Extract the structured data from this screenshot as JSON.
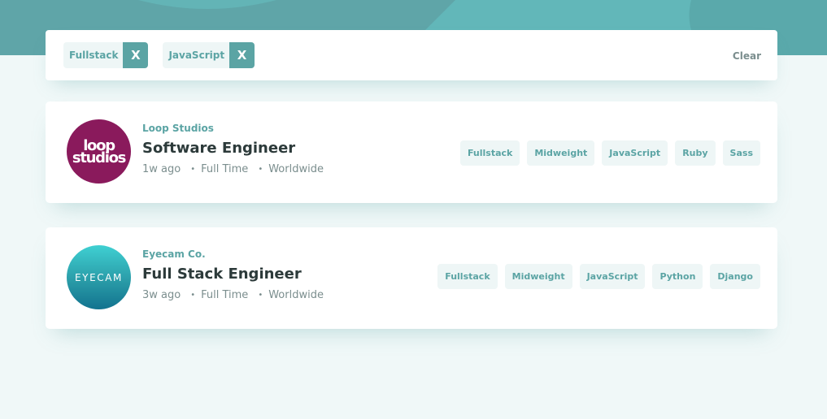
{
  "filters": {
    "active": [
      {
        "label": "Fullstack",
        "remove_label": "X"
      },
      {
        "label": "JavaScript",
        "remove_label": "X"
      }
    ],
    "clear_label": "Clear"
  },
  "jobs": [
    {
      "company": "Loop Studios",
      "logo_text": "loop studios",
      "logo_color": "#8a1a5c",
      "position": "Software Engineer",
      "posted": "1w ago",
      "contract": "Full Time",
      "location": "Worldwide",
      "tags": [
        "Fullstack",
        "Midweight",
        "JavaScript",
        "Ruby",
        "Sass"
      ]
    },
    {
      "company": "Eyecam Co.",
      "logo_text": "EYECAM",
      "logo_color": "#2a9ca8",
      "position": "Full Stack Engineer",
      "posted": "3w ago",
      "contract": "Full Time",
      "location": "Worldwide",
      "tags": [
        "Fullstack",
        "Midweight",
        "JavaScript",
        "Python",
        "Django"
      ]
    }
  ],
  "colors": {
    "primary": "#5ba4a4",
    "background": "#f0f8f8",
    "tag_bg": "#eef6f6",
    "text_dark": "#2c3a3a",
    "text_gray": "#7b8e8e"
  }
}
